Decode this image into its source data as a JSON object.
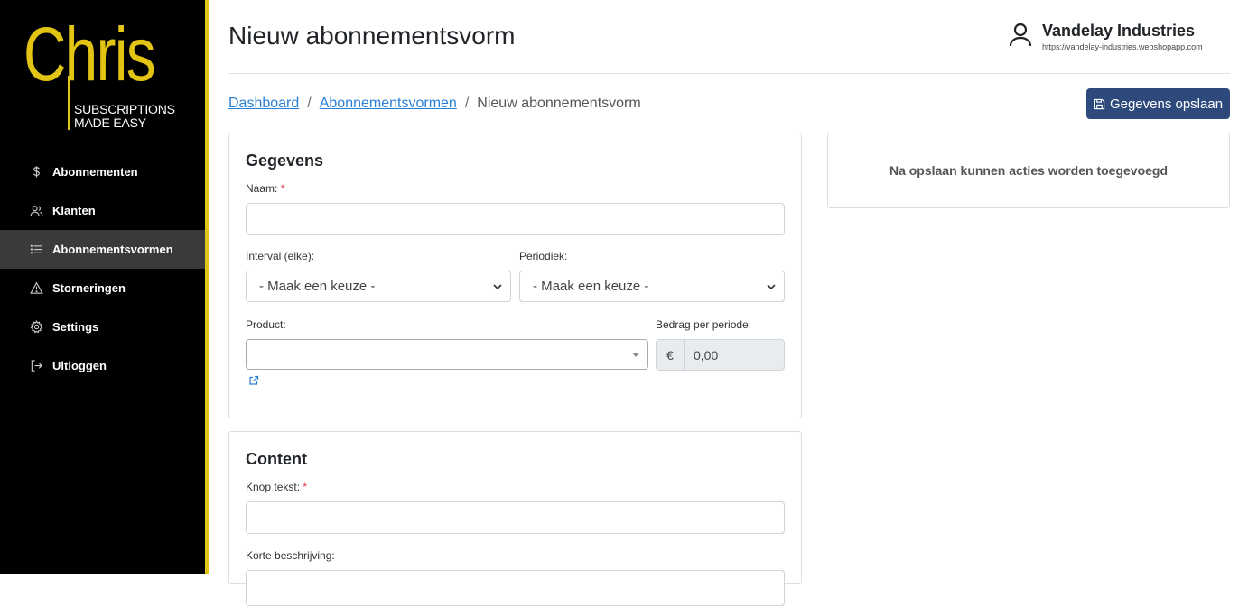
{
  "sidebar": {
    "logo": {
      "word": "Chris",
      "tag_line1": "SUBSCRIPTIONS",
      "tag_line2": "MADE EASY"
    },
    "items": [
      {
        "label": "Abonnementen",
        "icon": "dollar-icon",
        "active": false
      },
      {
        "label": "Klanten",
        "icon": "users-icon",
        "active": false
      },
      {
        "label": "Abonnementsvormen",
        "icon": "list-icon",
        "active": true
      },
      {
        "label": "Storneringen",
        "icon": "warning-icon",
        "active": false
      },
      {
        "label": "Settings",
        "icon": "gear-icon",
        "active": false
      },
      {
        "label": "Uitloggen",
        "icon": "logout-icon",
        "active": false
      }
    ],
    "colors": {
      "background": "#000000",
      "accent": "#e1c414"
    }
  },
  "header": {
    "title": "Nieuw abonnementsvorm",
    "user": {
      "name": "Vandelay Industries",
      "url": "https://vandelay-industries.webshopapp.com",
      "icon": "user-icon"
    }
  },
  "breadcrumb": {
    "items": [
      "Dashboard",
      "Abonnementsvormen",
      "Nieuw abonnementsvorm"
    ],
    "separator": "/"
  },
  "toolbar": {
    "save_label": "Gegevens opslaan",
    "save_icon": "floppy-icon",
    "save_color": "#2e4a7d"
  },
  "gegevens": {
    "title": "Gegevens",
    "naam_label": "Naam:",
    "naam_value": "",
    "interval_label": "Interval (elke):",
    "interval_value": "- Maak een keuze -",
    "periodiek_label": "Periodiek:",
    "periodiek_value": "- Maak een keuze -",
    "product_label": "Product:",
    "product_value": "",
    "bedrag_label": "Bedrag per periode:",
    "bedrag_currency": "€",
    "bedrag_value": "0,00"
  },
  "content": {
    "title": "Content",
    "knop_label": "Knop tekst:",
    "knop_value": "",
    "korte_label": "Korte beschrijving:"
  },
  "side_panel": {
    "message": "Na opslaan kunnen acties worden toegevoegd"
  },
  "required_marker": "*"
}
